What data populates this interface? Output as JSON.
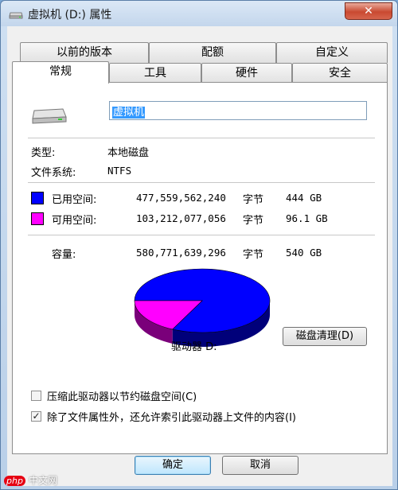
{
  "window": {
    "title": "虚拟机 (D:) 属性",
    "close_label": "✕"
  },
  "tabs": {
    "row_back": [
      "以前的版本",
      "配额",
      "自定义"
    ],
    "row_front": [
      "常规",
      "工具",
      "硬件",
      "安全"
    ]
  },
  "general": {
    "name_value": "虚拟机",
    "type_label": "类型:",
    "type_value": "本地磁盘",
    "fs_label": "文件系统:",
    "fs_value": "NTFS",
    "used": {
      "label": "已用空间:",
      "bytes": "477,559,562,240",
      "unit": "字节",
      "size": "444 GB",
      "color": "#0000ff"
    },
    "free": {
      "label": "可用空间:",
      "bytes": "103,212,077,056",
      "unit": "字节",
      "size": "96.1 GB",
      "color": "#ff00ff"
    },
    "capacity": {
      "label": "容量:",
      "bytes": "580,771,639,296",
      "unit": "字节",
      "size": "540 GB"
    },
    "drive_label": "驱动器 D:",
    "cleanup_button": "磁盘清理(D)",
    "compress_option": {
      "label": "压缩此驱动器以节约磁盘空间(C)",
      "checked": false
    },
    "index_option": {
      "label": "除了文件属性外，还允许索引此驱动器上文件的内容(I)",
      "checked": true,
      "mark": "✓"
    }
  },
  "pie": {
    "used_fraction": 0.8223,
    "free_fraction": 0.1777,
    "used_color": "#0000ff",
    "free_color": "#ff00ff"
  },
  "footer": {
    "ok_label": "确定",
    "cancel_label": "取消"
  },
  "watermark": {
    "php": "php",
    "site": "中文网"
  }
}
